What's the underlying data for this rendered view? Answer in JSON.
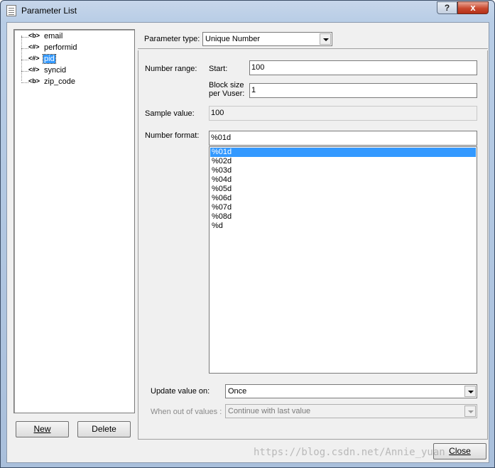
{
  "window": {
    "title": "Parameter List",
    "help_label": "?",
    "close_label": "x"
  },
  "tree": {
    "items": [
      {
        "tag": "<b>",
        "label": "email"
      },
      {
        "tag": "<#>",
        "label": "performid"
      },
      {
        "tag": "<#>",
        "label": "pid"
      },
      {
        "tag": "<#>",
        "label": "syncid"
      },
      {
        "tag": "<b>",
        "label": "zip_code"
      }
    ],
    "selected": "pid"
  },
  "buttons": {
    "new_label": "New",
    "delete_label": "Delete",
    "close_label": "Close"
  },
  "param_type": {
    "label": "Parameter type:",
    "value": "Unique Number"
  },
  "number_range": {
    "label": "Number range:",
    "start_label": "Start:",
    "start_value": "100",
    "block_label_1": "Block size",
    "block_label_2": "per Vuser:",
    "block_value": "1"
  },
  "sample": {
    "label": "Sample value:",
    "value": "100"
  },
  "number_format": {
    "label": "Number format:",
    "value": "%01d",
    "options": [
      "%01d",
      "%02d",
      "%03d",
      "%04d",
      "%05d",
      "%06d",
      "%07d",
      "%08d",
      "%d"
    ],
    "selected": "%01d"
  },
  "update": {
    "label": "Update value on:",
    "value": "Once"
  },
  "out_of_values": {
    "label": "When out of values :",
    "value": "Continue with last value"
  },
  "watermark": "https://blog.csdn.net/Annie_yuan"
}
